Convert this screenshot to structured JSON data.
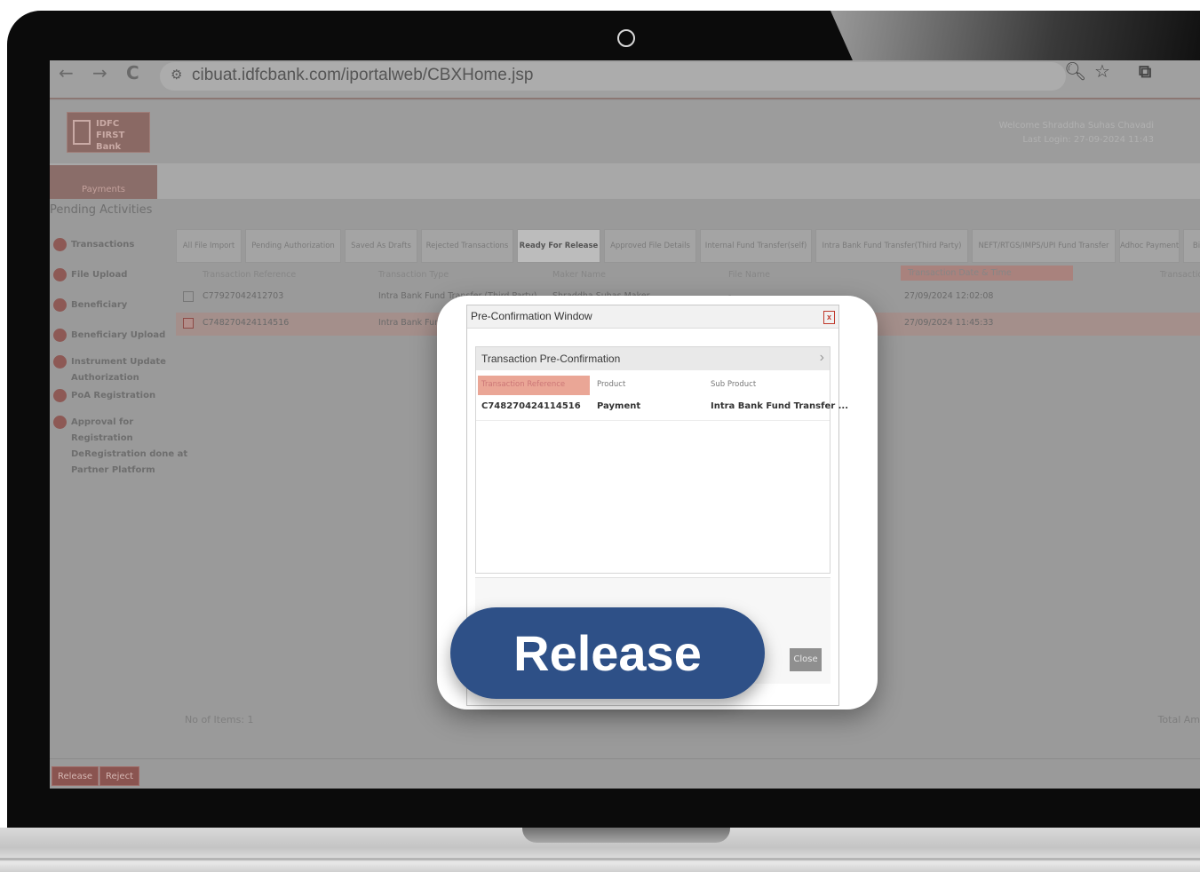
{
  "browser": {
    "url": "cibuat.idfcbank.com/iportalweb/CBXHome.jsp",
    "back_icon": "←",
    "forward_icon": "→",
    "reload_icon": "C"
  },
  "app": {
    "logo_text": "IDFC FIRST Bank",
    "welcome_line1": "Welcome Shraddha Suhas Chavadi",
    "welcome_line2": "Last Login: 27-09-2024 11:43",
    "menu_tab": "Payments",
    "section_title": "Pending Activities"
  },
  "sidebar": {
    "items": [
      {
        "label": "Transactions"
      },
      {
        "label": "File Upload"
      },
      {
        "label": "Beneficiary"
      },
      {
        "label": "Beneficiary Upload"
      },
      {
        "label": "Instrument Update"
      },
      {
        "label": "Authorization"
      },
      {
        "label": "PoA Registration"
      },
      {
        "label": "Approval for"
      },
      {
        "label": "Registration"
      },
      {
        "label": "DeRegistration done at"
      },
      {
        "label": "Partner Platform"
      }
    ]
  },
  "tabs": [
    {
      "label": "All File Import"
    },
    {
      "label": "Pending Authorization"
    },
    {
      "label": "Saved As Drafts"
    },
    {
      "label": "Rejected Transactions"
    },
    {
      "label": "Ready For Release"
    },
    {
      "label": "Approved File Details"
    },
    {
      "label": "Internal Fund Transfer(self)"
    },
    {
      "label": "Intra Bank Fund Transfer(Third Party)"
    },
    {
      "label": "NEFT/RTGS/IMPS/UPI Fund Transfer"
    },
    {
      "label": "Adhoc Payments"
    },
    {
      "label": "Bi"
    }
  ],
  "table": {
    "headers": [
      "Transaction Reference",
      "Transaction Type",
      "Maker Name",
      "File Name",
      "Transaction Date & Time",
      "Transactio"
    ],
    "rows": [
      {
        "ref": "C77927042412703",
        "type": "Intra Bank Fund Transfer (Third Party)",
        "maker": "Shraddha Suhas Maker",
        "file": "-",
        "date": "27/09/2024 12:02:08"
      },
      {
        "ref": "C748270424114516",
        "type": "Intra Bank Fund Tran",
        "maker": "",
        "file": "",
        "date": "27/09/2024 11:45:33"
      }
    ],
    "footer_count": "No of Items: 1",
    "footer_total": "Total Am"
  },
  "bottom_buttons": {
    "release": "Release",
    "reject": "Reject"
  },
  "dialog": {
    "title": "Pre-Confirmation Window",
    "close_x": "x",
    "panel_title": "Transaction Pre-Confirmation",
    "headers": [
      "Transaction Reference",
      "Product",
      "Sub Product"
    ],
    "row": {
      "ref": "C748270424114516",
      "product": "Payment",
      "sub_product": "Intra Bank Fund Transfer ..."
    },
    "close_button": "Close"
  },
  "callout": {
    "label": "Release"
  }
}
